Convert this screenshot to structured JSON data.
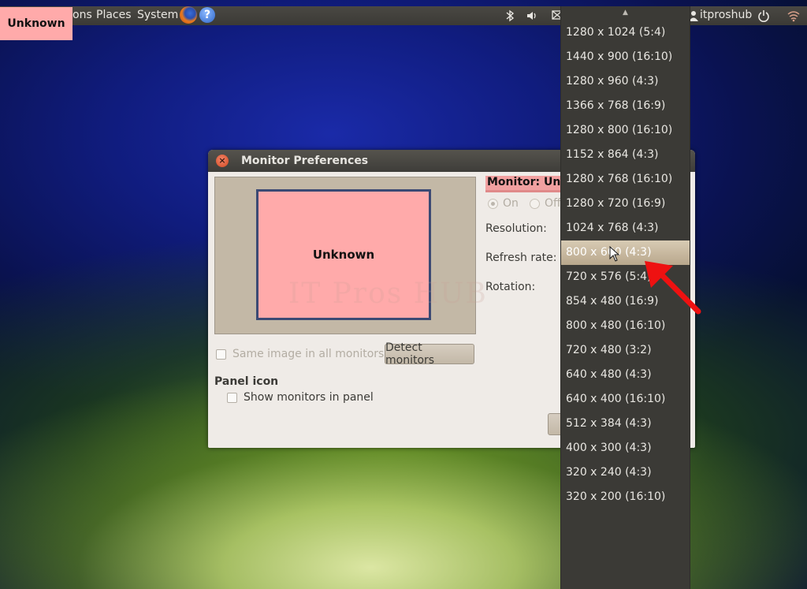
{
  "top_panel": {
    "menus": [
      "ons",
      "Places",
      "System"
    ],
    "user": "itproshub"
  },
  "badge": {
    "label": "Unknown"
  },
  "dialog": {
    "title": "Monitor Preferences",
    "monitor_box_label": "Unknown",
    "watermark": "IT Pros HUB",
    "monitor_label": "Monitor: Unk",
    "radio_on": "On",
    "radio_off": "Off",
    "resolution_label": "Resolution:",
    "refresh_label": "Refresh rate:",
    "rotation_label": "Rotation:",
    "same_image_label": "Same image in all monitors",
    "detect_button": "Detect monitors",
    "panel_icon_heading": "Panel icon",
    "show_monitors_label": "Show monitors in panel"
  },
  "resolution_menu": {
    "scroll_up_glyph": "▲",
    "selected_index": 9,
    "items": [
      "1280 x 1024 (5:4)",
      "1440 x 900 (16:10)",
      "1280 x 960 (4:3)",
      "1366 x 768 (16:9)",
      "1280 x 800 (16:10)",
      "1152 x 864 (4:3)",
      "1280 x 768 (16:10)",
      "1280 x 720 (16:9)",
      "1024 x 768 (4:3)",
      "800 x 600 (4:3)",
      "720 x 576 (5:4)",
      "854 x 480 (16:9)",
      "800 x 480 (16:10)",
      "720 x 480 (3:2)",
      "640 x 480 (4:3)",
      "640 x 400 (16:10)",
      "512 x 384 (4:3)",
      "400 x 300 (4:3)",
      "320 x 240 (4:3)",
      "320 x 200 (16:10)"
    ]
  },
  "colors": {
    "accent_pink": "#ffaaaa",
    "arrow_red": "#ee1111",
    "menu_bg": "#3b3a36",
    "selected_item": "#c7b89f"
  }
}
